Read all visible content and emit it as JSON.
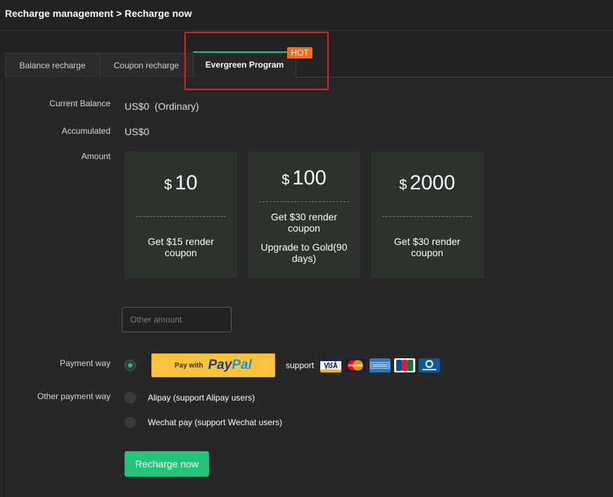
{
  "breadcrumb": "Recharge management > Recharge now",
  "tabs": [
    {
      "label": "Balance recharge"
    },
    {
      "label": "Coupon recharge"
    },
    {
      "label": "Evergreen Program",
      "badge": "HOT"
    }
  ],
  "balance": {
    "label": "Current Balance",
    "value": "US$0  (Ordinary)"
  },
  "accumulated": {
    "label": "Accumulated",
    "value": "US$0"
  },
  "amount": {
    "label": "Amount",
    "cards": [
      {
        "currency": "$",
        "amount": "10",
        "perks": [
          "Get $15 render coupon"
        ]
      },
      {
        "currency": "$",
        "amount": "100",
        "perks": [
          "Get $30 render coupon",
          "Upgrade to Gold(90 days)"
        ]
      },
      {
        "currency": "$",
        "amount": "2000",
        "perks": [
          "Get $30 render coupon"
        ]
      }
    ],
    "other_placeholder": "Other amount"
  },
  "payment": {
    "label": "Payment way",
    "paypal_prefix": "Pay with",
    "paypal_brand_1": "Pay",
    "paypal_brand_2": "Pal",
    "support_label": "support",
    "card_icons": [
      "visa-icon",
      "mastercard-icon",
      "amex-icon",
      "jcb-icon",
      "diners-club-icon"
    ]
  },
  "other_payment": {
    "label": "Other payment way",
    "options": [
      {
        "label": "Alipay (support Alipay users)"
      },
      {
        "label": "Wechat pay (support Wechat users)"
      }
    ]
  },
  "submit_label": "Recharge now",
  "colors": {
    "accent": "#23c57b",
    "hot": "#f26d21",
    "highlight": "#e0201f",
    "card_bg": "#2c332d",
    "paypal_yellow": "#fcc33c"
  }
}
